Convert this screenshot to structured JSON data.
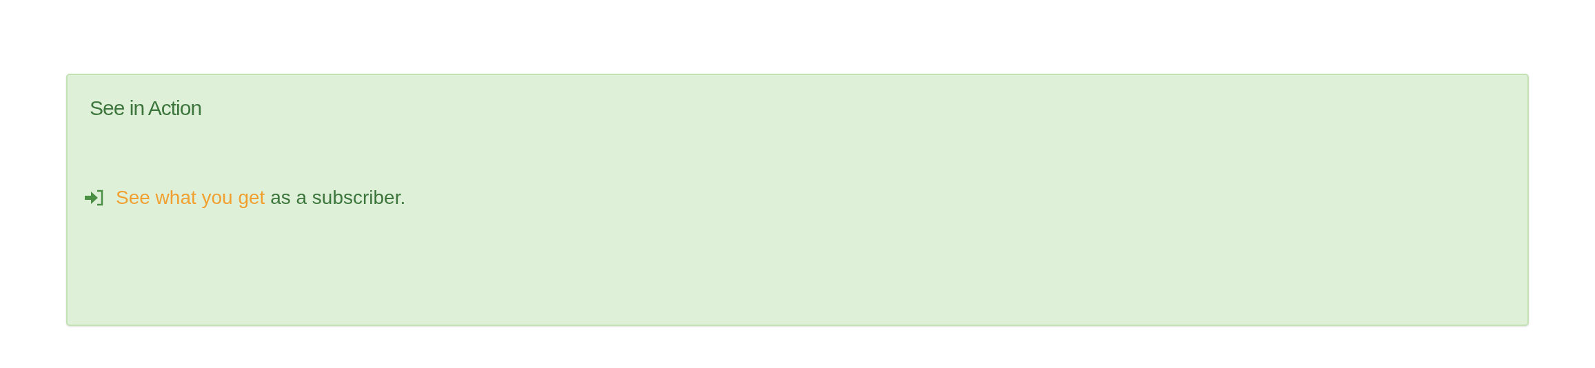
{
  "panel": {
    "title": "See in Action",
    "message": {
      "link": "See what you get",
      "text": " as a subscriber."
    }
  }
}
